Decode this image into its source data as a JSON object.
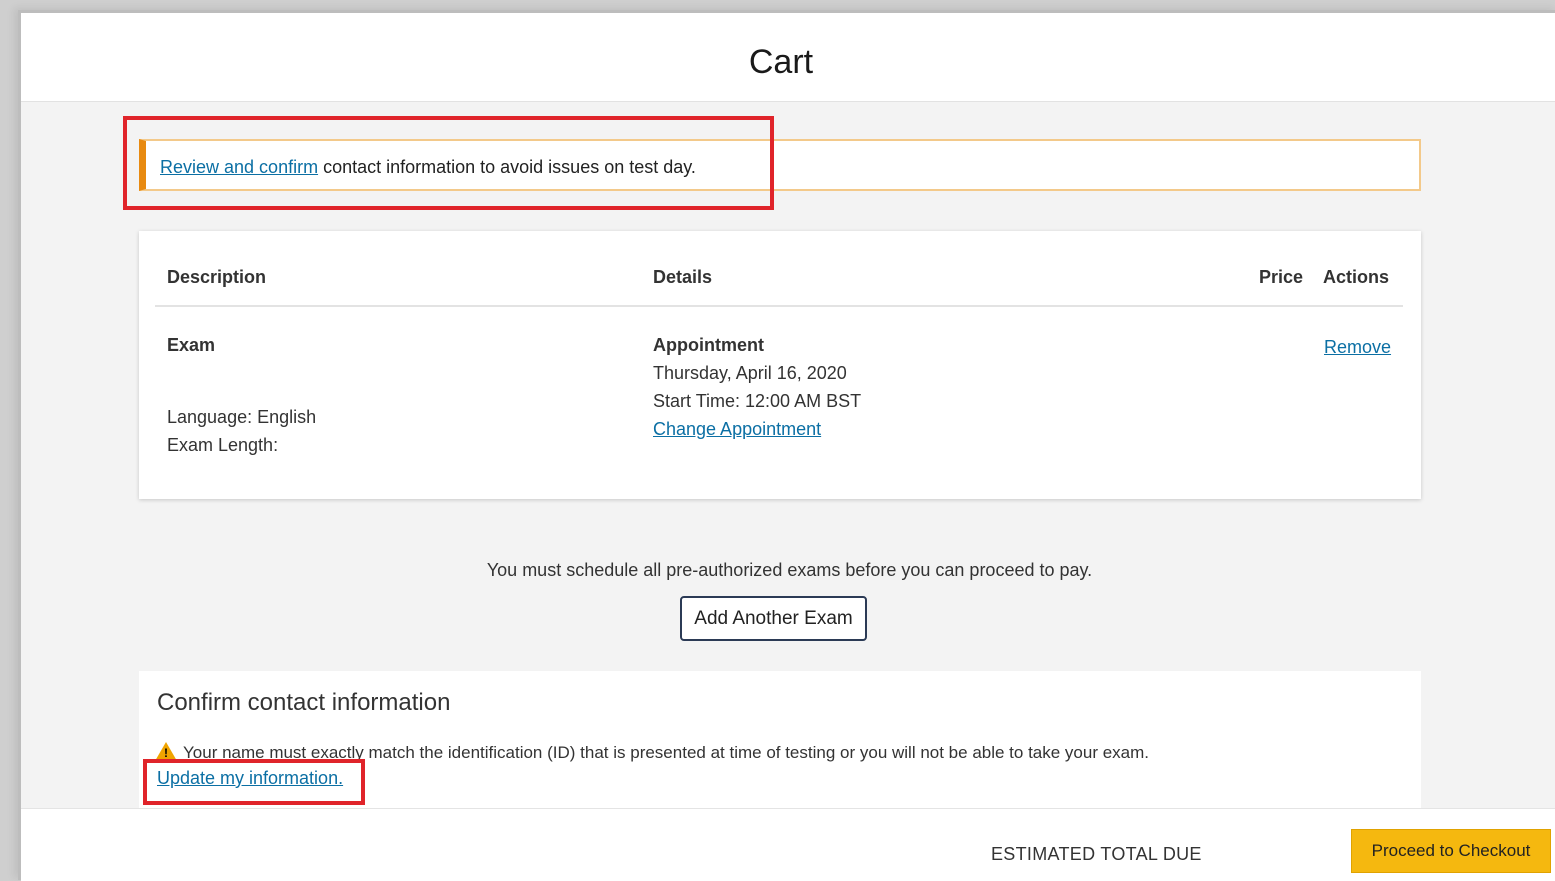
{
  "page": {
    "title": "Cart"
  },
  "alert": {
    "link_text": "Review and confirm",
    "text": " contact information to avoid issues on test day."
  },
  "table": {
    "headers": {
      "description": "Description",
      "details": "Details",
      "price": "Price",
      "actions": "Actions"
    },
    "row": {
      "description_title": "Exam",
      "language": "Language: English",
      "exam_length": "Exam Length:",
      "details_title": "Appointment",
      "date": "Thursday, April 16, 2020",
      "start_time": "Start Time: 12:00 AM BST",
      "change_link": "Change Appointment",
      "remove_link": "Remove"
    }
  },
  "schedule_note": "You must schedule all pre-authorized exams before you can proceed to pay.",
  "add_exam_button": "Add Another Exam",
  "contact": {
    "title": "Confirm contact information",
    "warning": "Your name must exactly match the identification (ID) that is presented at time of testing or you will not be able to take your exam.",
    "update_link": "Update my information."
  },
  "footer": {
    "total_label": "ESTIMATED TOTAL DUE",
    "checkout_button": "Proceed to Checkout"
  },
  "colors": {
    "accent_orange": "#e88a10",
    "highlight_red": "#e0242a",
    "link_blue": "#0b6fa4",
    "checkout_yellow": "#f5b80f"
  },
  "icons": {
    "warning": "warning-triangle-icon"
  }
}
